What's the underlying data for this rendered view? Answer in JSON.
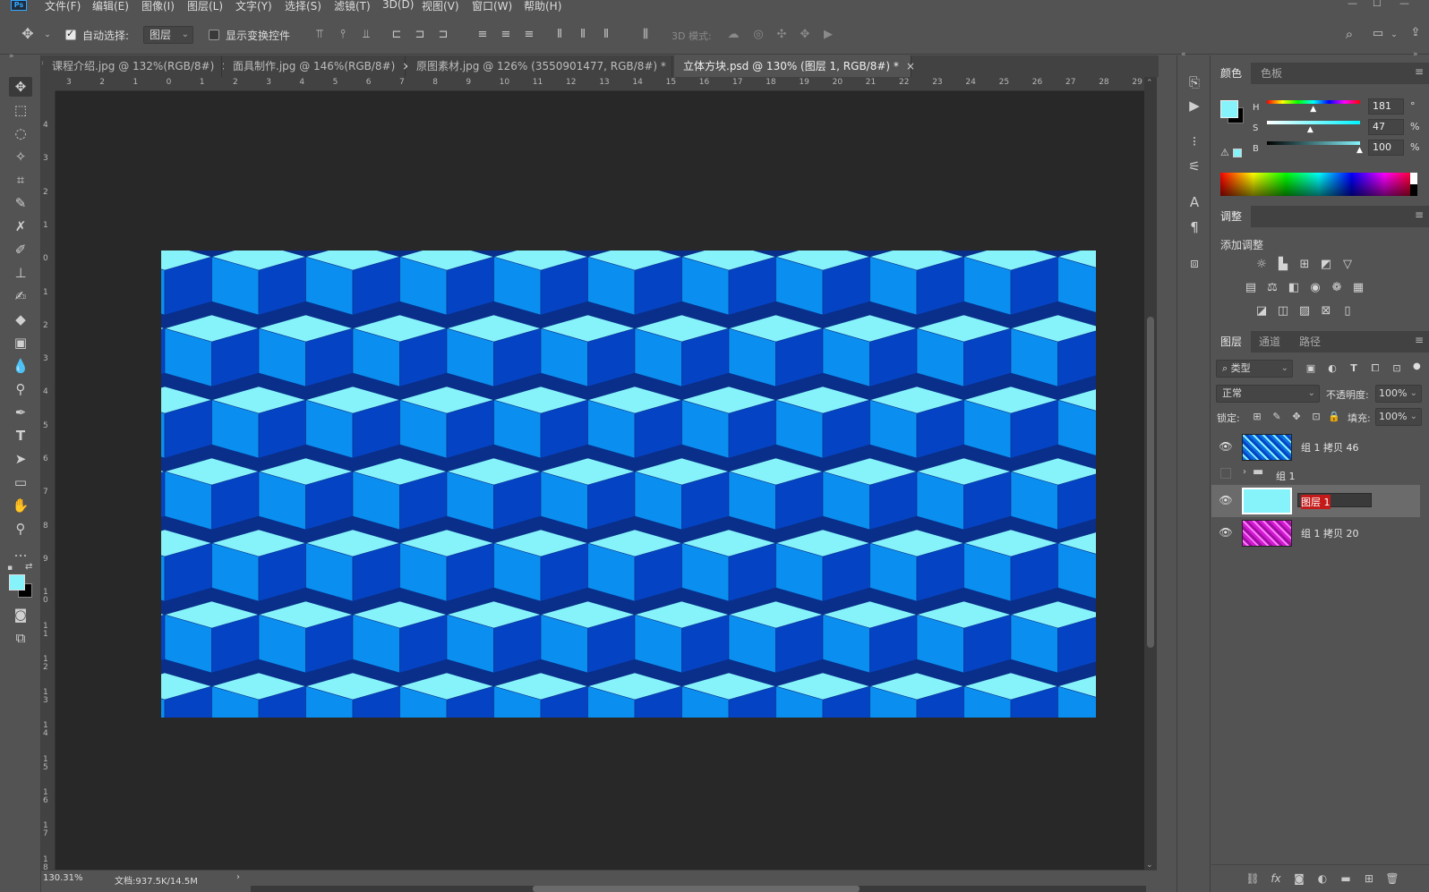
{
  "menu": {
    "app_logo": "Ps",
    "items": [
      "文件(F)",
      "编辑(E)",
      "图像(I)",
      "图层(L)",
      "文字(Y)",
      "选择(S)",
      "滤镜(T)",
      "3D(D)",
      "视图(V)",
      "窗口(W)",
      "帮助(H)"
    ]
  },
  "options": {
    "auto_select_label": "自动选择:",
    "auto_select_checked": true,
    "auto_select_target": "图层",
    "show_transform_label": "显示变换控件",
    "show_transform_checked": false,
    "mode_3d_label": "3D 模式:"
  },
  "tabs": [
    {
      "label": "课程介绍.jpg @ 132%(RGB/8#)",
      "active": false
    },
    {
      "label": "面具制作.jpg @ 146%(RGB/8#)",
      "active": false
    },
    {
      "label": "原图素材.jpg @ 126% (3550901477, RGB/8#) *",
      "active": false
    },
    {
      "label": "立体方块.psd @ 130% (图层 1, RGB/8#) *",
      "active": true
    }
  ],
  "ruler": {
    "top": [
      "3",
      "2",
      "1",
      "0",
      "1",
      "2",
      "3",
      "4",
      "5",
      "6",
      "7",
      "8",
      "9",
      "10",
      "11",
      "12",
      "13",
      "14",
      "15",
      "16",
      "17",
      "18",
      "19",
      "20",
      "21",
      "22",
      "23",
      "24",
      "25",
      "26",
      "27",
      "28",
      "29"
    ],
    "left": [
      "4",
      "3",
      "2",
      "1",
      "0",
      "1",
      "2",
      "3",
      "4",
      "5",
      "6",
      "7",
      "8",
      "9",
      "1\n0",
      "1\n1",
      "1\n2",
      "1\n3",
      "1\n4",
      "1\n5",
      "1\n6",
      "1\n7",
      "1\n8"
    ]
  },
  "status": {
    "zoom": "130.31%",
    "doc_info": "文档:937.5K/14.5M"
  },
  "color_panel": {
    "tabs": [
      "颜色",
      "色板"
    ],
    "h_label": "H",
    "h_value": "181",
    "h_unit": "°",
    "s_label": "S",
    "s_value": "47",
    "s_unit": "%",
    "b_label": "B",
    "b_value": "100",
    "b_unit": "%",
    "foreground": "#86f3fb",
    "background": "#000000",
    "h_fraction": 0.503,
    "s_fraction": 0.47,
    "b_fraction": 1.0
  },
  "adjust_panel": {
    "tab": "调整",
    "add_label": "添加调整"
  },
  "layers_panel": {
    "tabs": [
      "图层",
      "通道",
      "路径"
    ],
    "filter_label": "类型",
    "blend_mode": "正常",
    "opacity_label": "不透明度:",
    "opacity_value": "100%",
    "lock_label": "锁定:",
    "fill_label": "填充:",
    "fill_value": "100%",
    "layers": [
      {
        "name": "组 1 拷贝 46",
        "visible": true,
        "kind": "pattern-blue"
      },
      {
        "name": "组 1",
        "visible": false,
        "kind": "group"
      },
      {
        "name": "图层 1",
        "visible": true,
        "kind": "cyan",
        "selected": true
      },
      {
        "name": "组 1 拷贝 20",
        "visible": true,
        "kind": "pattern-magenta"
      }
    ]
  },
  "colors": {
    "cube_top": "#86f3fb",
    "cube_left": "#0a8ff0",
    "cube_right": "#0444c4",
    "outline": "#0a2f8a"
  }
}
